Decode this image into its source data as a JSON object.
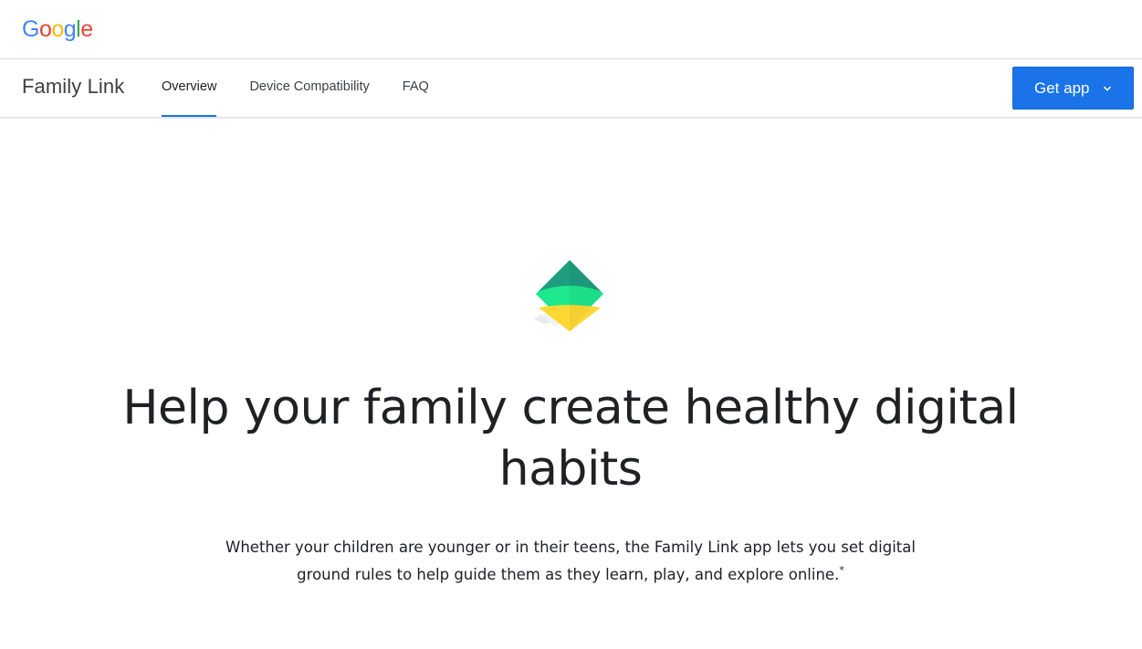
{
  "header": {
    "logo_text": "Google",
    "logo_colors": [
      "#4285F4",
      "#EA4335",
      "#FBBC05",
      "#4285F4",
      "#34A853",
      "#EA4335"
    ]
  },
  "subnav": {
    "product_name": "Family Link",
    "tabs": [
      {
        "label": "Overview",
        "active": true
      },
      {
        "label": "Device Compatibility",
        "active": false
      },
      {
        "label": "FAQ",
        "active": false
      }
    ],
    "get_app": {
      "label": "Get app",
      "icon": "chevron-down-icon",
      "color": "#1a73e8"
    }
  },
  "hero": {
    "icon": "family-link-logo-icon",
    "headline": "Help your family create healthy digital habits",
    "description": "Whether your children are younger or in their teens, the Family Link app lets you set digital ground rules to help guide them as they learn, play, and explore online.",
    "footnote_marker": "*"
  },
  "colors": {
    "accent": "#1a73e8",
    "logo_teal": "#1e8e7e",
    "logo_green": "#1ee88e",
    "logo_yellow": "#fdd835"
  }
}
